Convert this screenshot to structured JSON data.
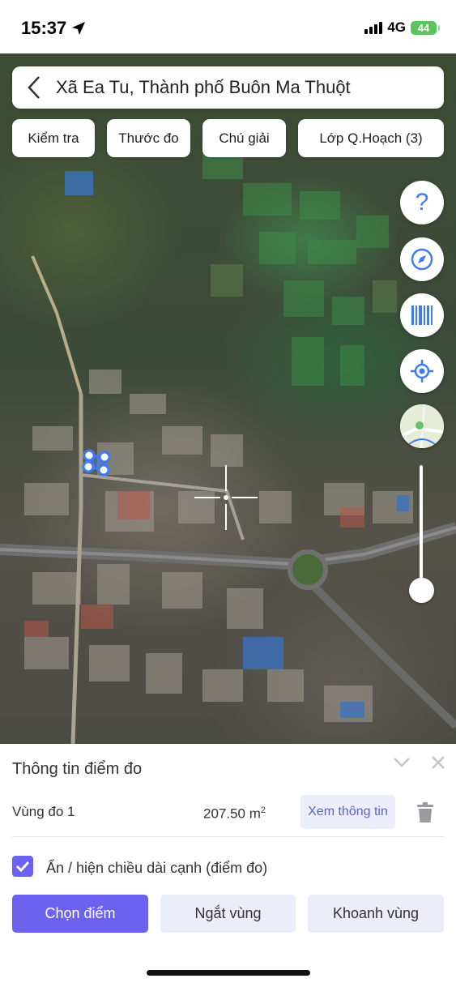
{
  "status_bar": {
    "time": "15:37",
    "network": "4G",
    "battery": "44"
  },
  "search": {
    "title": "Xã Ea Tu, Thành phố Buôn Ma Thuột"
  },
  "chips": [
    "Kiểm tra",
    "Thước đo",
    "Chú giải",
    "Lớp Q.Hoạch (3)"
  ],
  "map_controls": {
    "help": "?",
    "buttons": [
      "help-icon",
      "compass-icon",
      "barcode-icon",
      "locate-icon",
      "map-layer-thumbnail"
    ],
    "zoom_level": 0.9
  },
  "panel": {
    "title": "Thông tin điểm đo",
    "row": {
      "name": "Vùng đo 1",
      "area": "207.50 m",
      "area_unit_sup": "2",
      "info_button": "Xem thông tin"
    },
    "toggle_label": "Ẩn / hiện chiều dài cạnh (điểm đo)",
    "toggle_checked": true,
    "buttons": {
      "select": "Chọn điểm",
      "break": "Ngắt vùng",
      "area": "Khoanh vùng"
    }
  },
  "colors": {
    "accent": "#6b63f0",
    "accent_light": "#ebedf9",
    "link": "#5a62d6",
    "icon_blue": "#3e7bf6"
  }
}
